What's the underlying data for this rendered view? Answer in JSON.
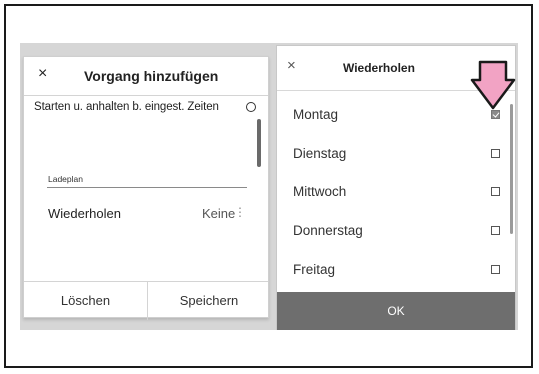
{
  "left_dialog": {
    "close_glyph": "×",
    "title": "Vorgang hinzufügen",
    "option_label": "Starten u. anhalten b. eingest. Zeiten",
    "section_label": "Ladeplan",
    "repeat_label": "Wiederholen",
    "repeat_value": "Keine",
    "more_glyph": "⋮",
    "delete_label": "Löschen",
    "save_label": "Speichern"
  },
  "right_dialog": {
    "close_glyph": "×",
    "title": "Wiederholen",
    "days": [
      {
        "label": "Montag",
        "checked": true
      },
      {
        "label": "Dienstag",
        "checked": false
      },
      {
        "label": "Mittwoch",
        "checked": false
      },
      {
        "label": "Donnerstag",
        "checked": false
      },
      {
        "label": "Freitag",
        "checked": false
      }
    ],
    "ok_label": "OK"
  },
  "colors": {
    "arrow_fill": "#f2a3c4",
    "arrow_stroke": "#1a1a1a",
    "ok_bar": "#6e6e6e",
    "backdrop": "#d6d6d6"
  },
  "icons": [
    "close-icon",
    "radio-icon",
    "more-vert-icon",
    "checkbox-icon",
    "pointer-arrow-icon"
  ]
}
